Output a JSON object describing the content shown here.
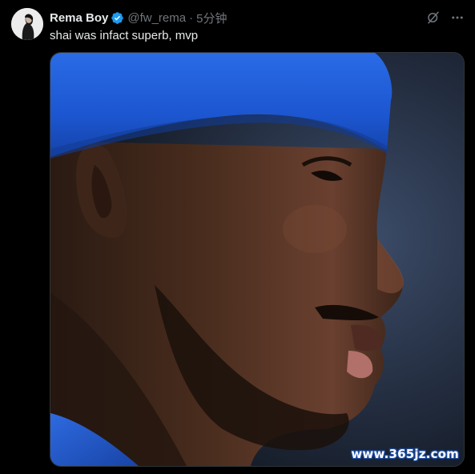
{
  "tweet": {
    "display_name": "Rema Boy",
    "handle": "@fw_rema",
    "separator": "·",
    "time": "5分钟",
    "text": "shai was infact superb, mvp"
  },
  "icons": {
    "verified": "verified-badge-icon",
    "grok": "grok-icon",
    "more": "more-icon"
  },
  "media": {
    "alt": "Close-up profile photo of a basketball player wearing a blue headband"
  },
  "watermark": {
    "text": "www.365jz.com"
  },
  "colors": {
    "background": "#000000",
    "text_primary": "#e7e9ea",
    "text_secondary": "#71767b",
    "verified_blue": "#1d9bf0",
    "headband_blue": "#1e5ad6",
    "watermark_outline": "#1e4fa8"
  }
}
